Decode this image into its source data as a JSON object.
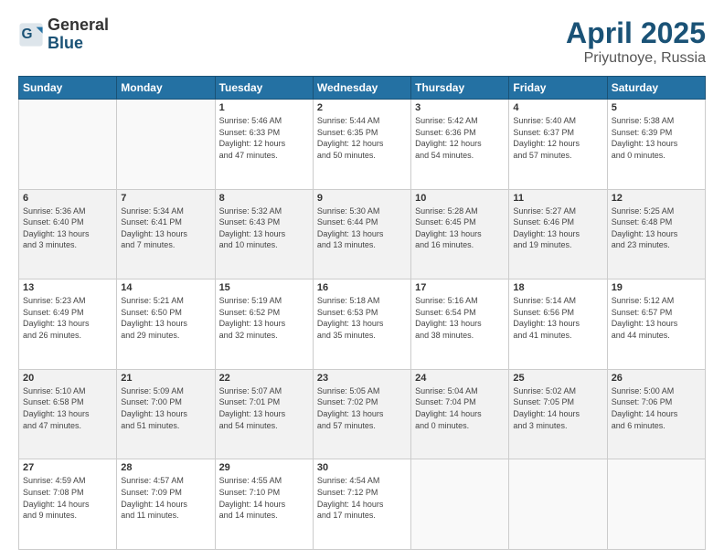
{
  "logo": {
    "general": "General",
    "blue": "Blue"
  },
  "title": {
    "month": "April 2025",
    "location": "Priyutnoye, Russia"
  },
  "headers": [
    "Sunday",
    "Monday",
    "Tuesday",
    "Wednesday",
    "Thursday",
    "Friday",
    "Saturday"
  ],
  "weeks": [
    [
      {
        "day": "",
        "detail": ""
      },
      {
        "day": "",
        "detail": ""
      },
      {
        "day": "1",
        "detail": "Sunrise: 5:46 AM\nSunset: 6:33 PM\nDaylight: 12 hours\nand 47 minutes."
      },
      {
        "day": "2",
        "detail": "Sunrise: 5:44 AM\nSunset: 6:35 PM\nDaylight: 12 hours\nand 50 minutes."
      },
      {
        "day": "3",
        "detail": "Sunrise: 5:42 AM\nSunset: 6:36 PM\nDaylight: 12 hours\nand 54 minutes."
      },
      {
        "day": "4",
        "detail": "Sunrise: 5:40 AM\nSunset: 6:37 PM\nDaylight: 12 hours\nand 57 minutes."
      },
      {
        "day": "5",
        "detail": "Sunrise: 5:38 AM\nSunset: 6:39 PM\nDaylight: 13 hours\nand 0 minutes."
      }
    ],
    [
      {
        "day": "6",
        "detail": "Sunrise: 5:36 AM\nSunset: 6:40 PM\nDaylight: 13 hours\nand 3 minutes."
      },
      {
        "day": "7",
        "detail": "Sunrise: 5:34 AM\nSunset: 6:41 PM\nDaylight: 13 hours\nand 7 minutes."
      },
      {
        "day": "8",
        "detail": "Sunrise: 5:32 AM\nSunset: 6:43 PM\nDaylight: 13 hours\nand 10 minutes."
      },
      {
        "day": "9",
        "detail": "Sunrise: 5:30 AM\nSunset: 6:44 PM\nDaylight: 13 hours\nand 13 minutes."
      },
      {
        "day": "10",
        "detail": "Sunrise: 5:28 AM\nSunset: 6:45 PM\nDaylight: 13 hours\nand 16 minutes."
      },
      {
        "day": "11",
        "detail": "Sunrise: 5:27 AM\nSunset: 6:46 PM\nDaylight: 13 hours\nand 19 minutes."
      },
      {
        "day": "12",
        "detail": "Sunrise: 5:25 AM\nSunset: 6:48 PM\nDaylight: 13 hours\nand 23 minutes."
      }
    ],
    [
      {
        "day": "13",
        "detail": "Sunrise: 5:23 AM\nSunset: 6:49 PM\nDaylight: 13 hours\nand 26 minutes."
      },
      {
        "day": "14",
        "detail": "Sunrise: 5:21 AM\nSunset: 6:50 PM\nDaylight: 13 hours\nand 29 minutes."
      },
      {
        "day": "15",
        "detail": "Sunrise: 5:19 AM\nSunset: 6:52 PM\nDaylight: 13 hours\nand 32 minutes."
      },
      {
        "day": "16",
        "detail": "Sunrise: 5:18 AM\nSunset: 6:53 PM\nDaylight: 13 hours\nand 35 minutes."
      },
      {
        "day": "17",
        "detail": "Sunrise: 5:16 AM\nSunset: 6:54 PM\nDaylight: 13 hours\nand 38 minutes."
      },
      {
        "day": "18",
        "detail": "Sunrise: 5:14 AM\nSunset: 6:56 PM\nDaylight: 13 hours\nand 41 minutes."
      },
      {
        "day": "19",
        "detail": "Sunrise: 5:12 AM\nSunset: 6:57 PM\nDaylight: 13 hours\nand 44 minutes."
      }
    ],
    [
      {
        "day": "20",
        "detail": "Sunrise: 5:10 AM\nSunset: 6:58 PM\nDaylight: 13 hours\nand 47 minutes."
      },
      {
        "day": "21",
        "detail": "Sunrise: 5:09 AM\nSunset: 7:00 PM\nDaylight: 13 hours\nand 51 minutes."
      },
      {
        "day": "22",
        "detail": "Sunrise: 5:07 AM\nSunset: 7:01 PM\nDaylight: 13 hours\nand 54 minutes."
      },
      {
        "day": "23",
        "detail": "Sunrise: 5:05 AM\nSunset: 7:02 PM\nDaylight: 13 hours\nand 57 minutes."
      },
      {
        "day": "24",
        "detail": "Sunrise: 5:04 AM\nSunset: 7:04 PM\nDaylight: 14 hours\nand 0 minutes."
      },
      {
        "day": "25",
        "detail": "Sunrise: 5:02 AM\nSunset: 7:05 PM\nDaylight: 14 hours\nand 3 minutes."
      },
      {
        "day": "26",
        "detail": "Sunrise: 5:00 AM\nSunset: 7:06 PM\nDaylight: 14 hours\nand 6 minutes."
      }
    ],
    [
      {
        "day": "27",
        "detail": "Sunrise: 4:59 AM\nSunset: 7:08 PM\nDaylight: 14 hours\nand 9 minutes."
      },
      {
        "day": "28",
        "detail": "Sunrise: 4:57 AM\nSunset: 7:09 PM\nDaylight: 14 hours\nand 11 minutes."
      },
      {
        "day": "29",
        "detail": "Sunrise: 4:55 AM\nSunset: 7:10 PM\nDaylight: 14 hours\nand 14 minutes."
      },
      {
        "day": "30",
        "detail": "Sunrise: 4:54 AM\nSunset: 7:12 PM\nDaylight: 14 hours\nand 17 minutes."
      },
      {
        "day": "",
        "detail": ""
      },
      {
        "day": "",
        "detail": ""
      },
      {
        "day": "",
        "detail": ""
      }
    ]
  ]
}
